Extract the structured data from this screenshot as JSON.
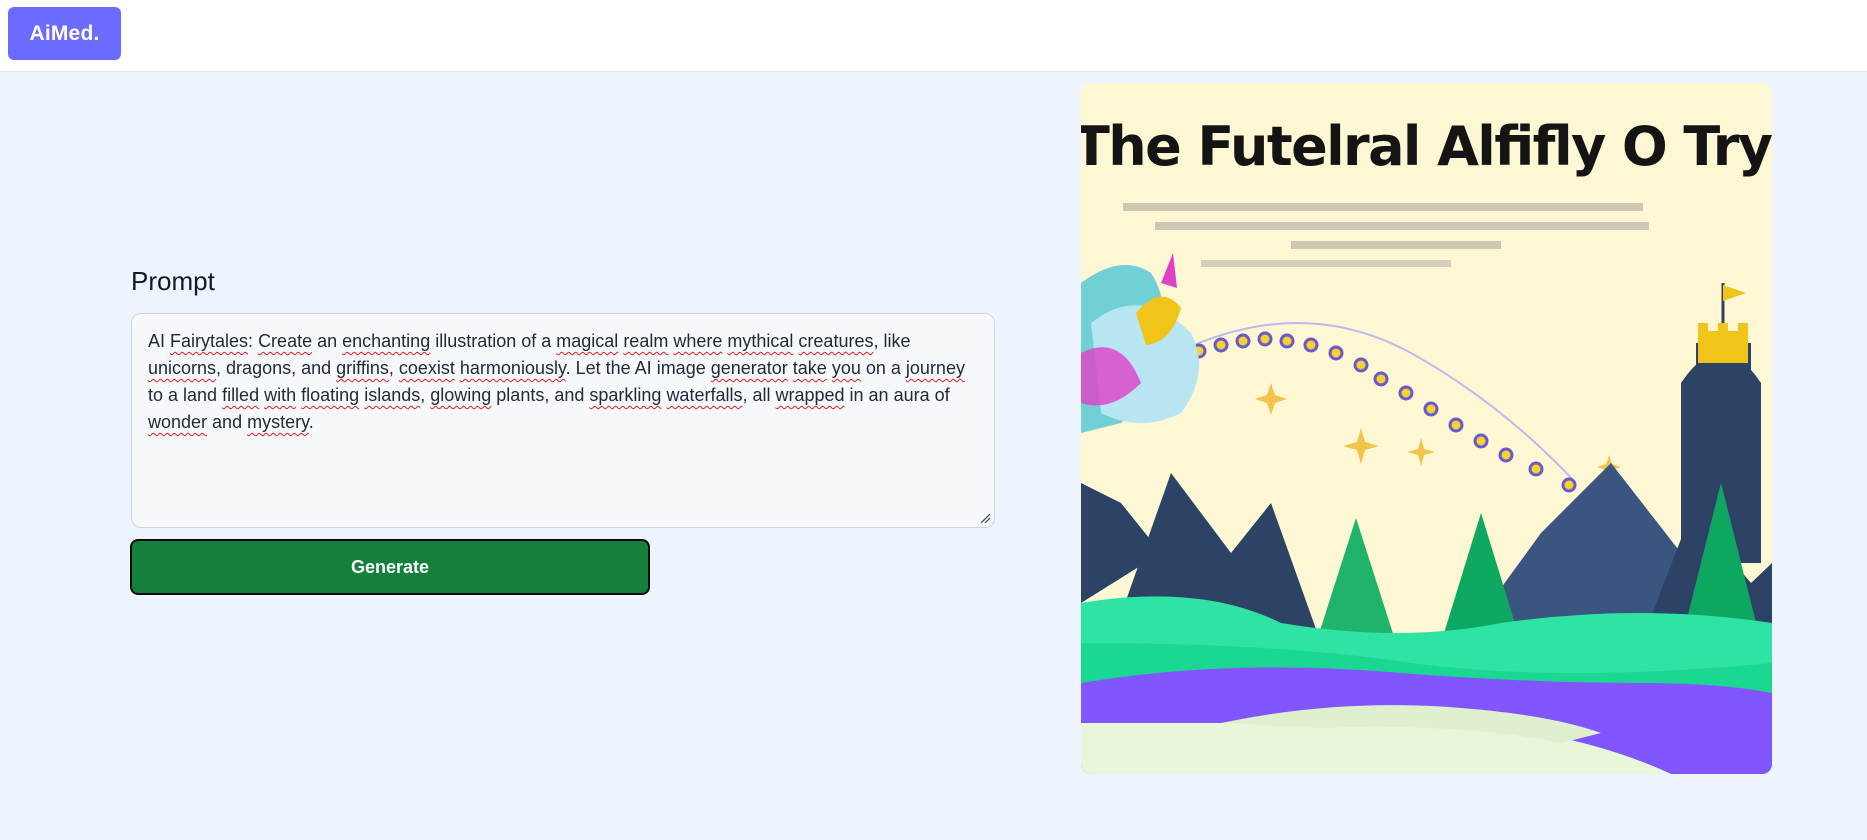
{
  "header": {
    "logo_text": "AiMed."
  },
  "form": {
    "prompt_label": "Prompt",
    "prompt_segments": [
      {
        "t": "AI ",
        "sp": false
      },
      {
        "t": "Fairytales",
        "sp": true
      },
      {
        "t": ": ",
        "sp": false
      },
      {
        "t": "Create",
        "sp": true
      },
      {
        "t": " an ",
        "sp": false
      },
      {
        "t": "enchanting",
        "sp": true
      },
      {
        "t": " illustration of a ",
        "sp": false
      },
      {
        "t": "magical",
        "sp": true
      },
      {
        "t": " ",
        "sp": false
      },
      {
        "t": "realm",
        "sp": true
      },
      {
        "t": " ",
        "sp": false
      },
      {
        "t": "where",
        "sp": true
      },
      {
        "t": " ",
        "sp": false
      },
      {
        "t": "mythical",
        "sp": true
      },
      {
        "t": " ",
        "sp": false
      },
      {
        "t": "creatures",
        "sp": true
      },
      {
        "t": ", like ",
        "sp": false
      },
      {
        "t": "unicorns",
        "sp": true
      },
      {
        "t": ", dragons, and ",
        "sp": false
      },
      {
        "t": "griffins",
        "sp": true
      },
      {
        "t": ", ",
        "sp": false
      },
      {
        "t": "coexist",
        "sp": true
      },
      {
        "t": " ",
        "sp": false
      },
      {
        "t": "harmoniously",
        "sp": true
      },
      {
        "t": ". Let the AI image ",
        "sp": false
      },
      {
        "t": "generator",
        "sp": true
      },
      {
        "t": " ",
        "sp": false
      },
      {
        "t": "take",
        "sp": true
      },
      {
        "t": " ",
        "sp": false
      },
      {
        "t": "you",
        "sp": true
      },
      {
        "t": " on a ",
        "sp": false
      },
      {
        "t": "journey",
        "sp": true
      },
      {
        "t": " to a land ",
        "sp": false
      },
      {
        "t": "filled",
        "sp": true
      },
      {
        "t": " ",
        "sp": false
      },
      {
        "t": "with",
        "sp": true
      },
      {
        "t": " ",
        "sp": false
      },
      {
        "t": "floating",
        "sp": true
      },
      {
        "t": " ",
        "sp": false
      },
      {
        "t": "islands",
        "sp": true
      },
      {
        "t": ", ",
        "sp": false
      },
      {
        "t": "glowing",
        "sp": true
      },
      {
        "t": " plants, and ",
        "sp": false
      },
      {
        "t": "sparkling",
        "sp": true
      },
      {
        "t": " ",
        "sp": false
      },
      {
        "t": "waterfalls",
        "sp": true
      },
      {
        "t": ", all ",
        "sp": false
      },
      {
        "t": "wrapped",
        "sp": true
      },
      {
        "t": " in an aura of ",
        "sp": false
      },
      {
        "t": "wonder",
        "sp": true
      },
      {
        "t": " and ",
        "sp": false
      },
      {
        "t": "mystery",
        "sp": true
      },
      {
        "t": ".",
        "sp": false
      }
    ],
    "generate_label": "Generate"
  },
  "result": {
    "image_title": "The Futelral Alfifly O Try"
  },
  "colors": {
    "logo_bg": "#6b6cff",
    "page_bg": "#eef4fd",
    "generate_bg": "#157f3d"
  }
}
